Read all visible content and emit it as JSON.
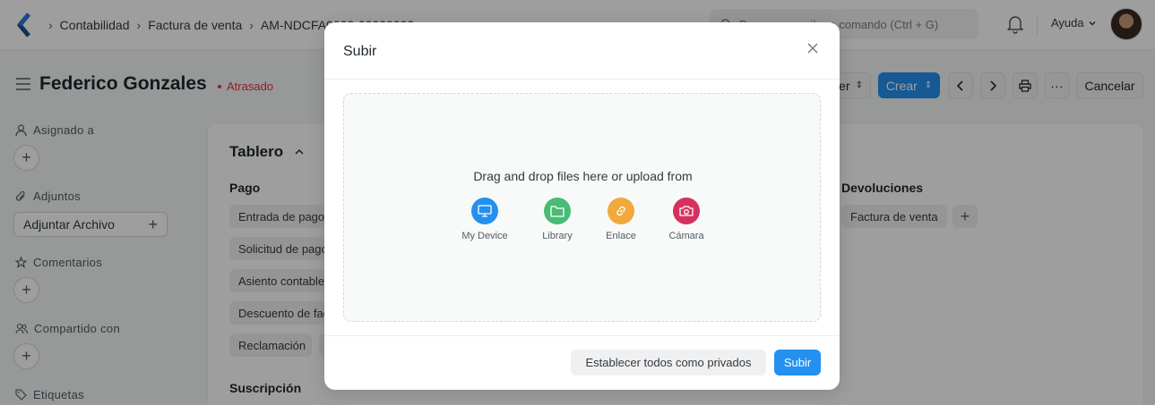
{
  "navbar": {
    "breadcrumbs": [
      "Contabilidad",
      "Factura de venta",
      "AM-NDCFA0002-00000002"
    ],
    "search_placeholder": "Buscar o escriba o comando (Ctrl + G)",
    "help_label": "Ayuda"
  },
  "page": {
    "title": "Federico Gonzales",
    "status": "Atrasado",
    "buttons": {
      "partial": "er",
      "create": "Crear",
      "cancel": "Cancelar"
    }
  },
  "sidebar": {
    "assigned": "Asignado a",
    "attachments": "Adjuntos",
    "attach_file": "Adjuntar Archivo",
    "comments": "Comentarios",
    "shared": "Compartido con",
    "tags": "Etiquetas"
  },
  "dashboard": {
    "title": "Tablero",
    "payment_group": "Pago",
    "payment_items": [
      "Entrada de pago",
      "Solicitud de pago",
      "Asiento contable",
      "Descuento de fac",
      "Reclamación"
    ],
    "returns_group": "Devoluciones",
    "returns_items": [
      "Factura de venta"
    ],
    "subscription_group": "Suscripción"
  },
  "modal": {
    "title": "Subir",
    "drop_text": "Drag and drop files here or upload from",
    "options": [
      {
        "label": "My Device",
        "icon": "monitor-icon",
        "color": "#2490ef"
      },
      {
        "label": "Library",
        "icon": "folder-icon",
        "color": "#48bb74"
      },
      {
        "label": "Enlace",
        "icon": "link-icon",
        "color": "#f0a93a"
      },
      {
        "label": "Cámara",
        "icon": "camera-icon",
        "color": "#d6305e"
      }
    ],
    "private_button": "Establecer todos como privados",
    "upload_button": "Subir"
  },
  "colors": {
    "primary": "#2490ef",
    "status_red": "#e03636"
  }
}
